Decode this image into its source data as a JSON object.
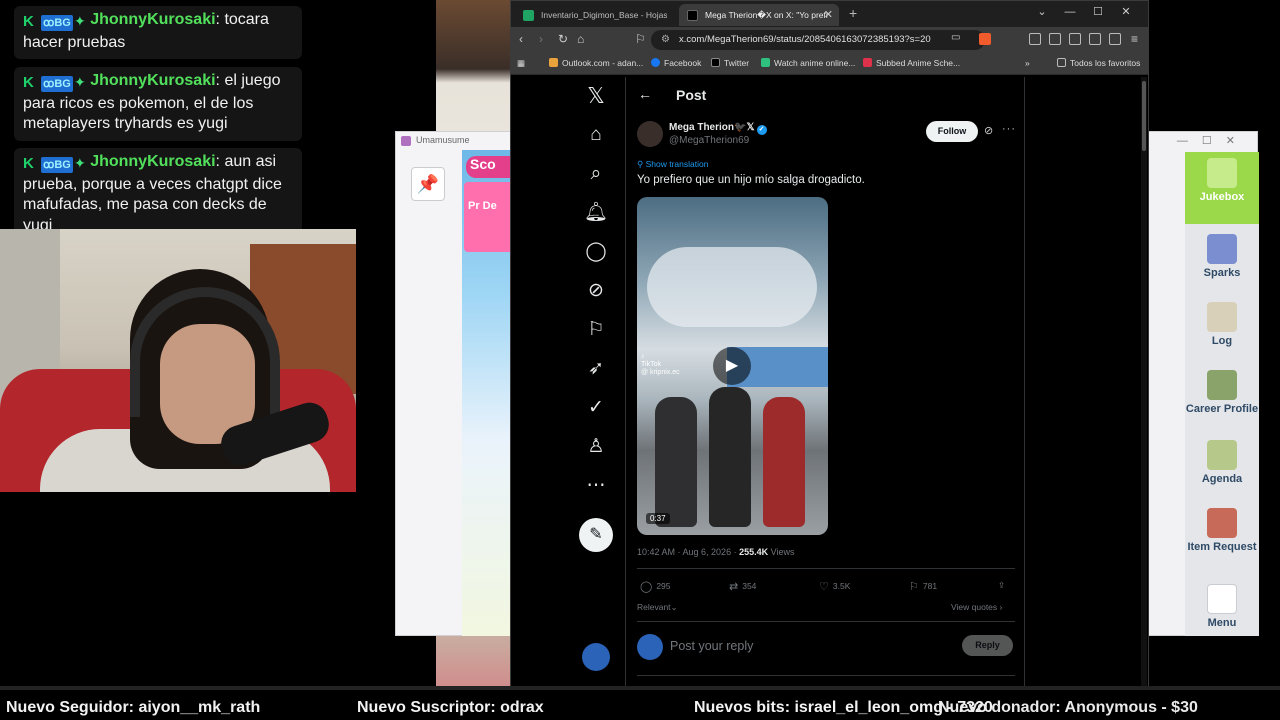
{
  "chat": {
    "badge_k": "K",
    "badge_bg": "ꝏBG",
    "badge_spark": "✦",
    "messages": [
      {
        "user": "JhonnyKurosaki",
        "text": ": tocara hacer pruebas"
      },
      {
        "user": "JhonnyKurosaki",
        "text": ": el juego para ricos es pokemon, el de los metaplayers tryhards es yugi"
      },
      {
        "user": "JhonnyKurosaki",
        "text": ": aun asi prueba, porque a veces chatgpt dice mafufadas, me pasa con decks de yugi"
      }
    ]
  },
  "uma_left": {
    "title": "Umamusume",
    "score_label": "Sco",
    "promo_label": "Pr De"
  },
  "uma_right": {
    "items": [
      {
        "label": "Jukebox",
        "icon": "jukebox-icon"
      },
      {
        "label": "Sparks",
        "icon": "sparks-icon"
      },
      {
        "label": "Log",
        "icon": "log-icon"
      },
      {
        "label": "Career Profile",
        "icon": "career-profile-icon"
      },
      {
        "label": "Agenda",
        "icon": "agenda-icon"
      },
      {
        "label": "Item Request",
        "icon": "item-request-icon"
      },
      {
        "label": "Menu",
        "icon": "menu-icon"
      }
    ]
  },
  "browser": {
    "tabs": [
      {
        "label": "Inventario_Digimon_Base - Hojas de",
        "active": false
      },
      {
        "label": "Mega Therion�X on X: \"Yo prefi",
        "active": true
      }
    ],
    "url": "x.com/MegaTherion69/status/2085406163072385193?s=20",
    "bookmarks": [
      "Outlook.com - adan...",
      "Facebook",
      "Twitter",
      "Watch anime online...",
      "Subbed Anime Sche..."
    ],
    "bookmarks_folder": "Todos los favoritos"
  },
  "x": {
    "page_title": "Post",
    "author_name": "Mega Therion🐦‍⬛𝕏",
    "author_handle": "@MegaTherion69",
    "follow_label": "Follow",
    "show_translation": "Show translation",
    "post_text": "Yo prefiero que un hijo mío salga drogadicto.",
    "video_duration": "0:37",
    "video_watermark": "TikTok",
    "video_watermark_handle": "@ kripnix.ec",
    "timestamp": "10:42 AM · Aug 6, 2026 · ",
    "views_count": "255.4K",
    "views_label": " Views",
    "replies": "295",
    "reposts": "354",
    "likes": "3.5K",
    "bookmarks": "781",
    "relevant_label": "Relevant⌄",
    "view_quotes": "View quotes ›",
    "reply_placeholder": "Post your reply",
    "reply_button": "Reply"
  },
  "ticker": {
    "follower": "Nuevo Seguidor: aiyon__mk_rath",
    "subscriber": "Nuevo Suscriptor: odrax",
    "bits": "Nuevos bits: israel_el_leon_omg - 7320",
    "donation": "Nuevo donador: Anonymous - $30"
  },
  "colors": {
    "chat_user": "#52e05c",
    "x_blue": "#1d9bf0",
    "uma_jukebox": "#9bd84a"
  }
}
